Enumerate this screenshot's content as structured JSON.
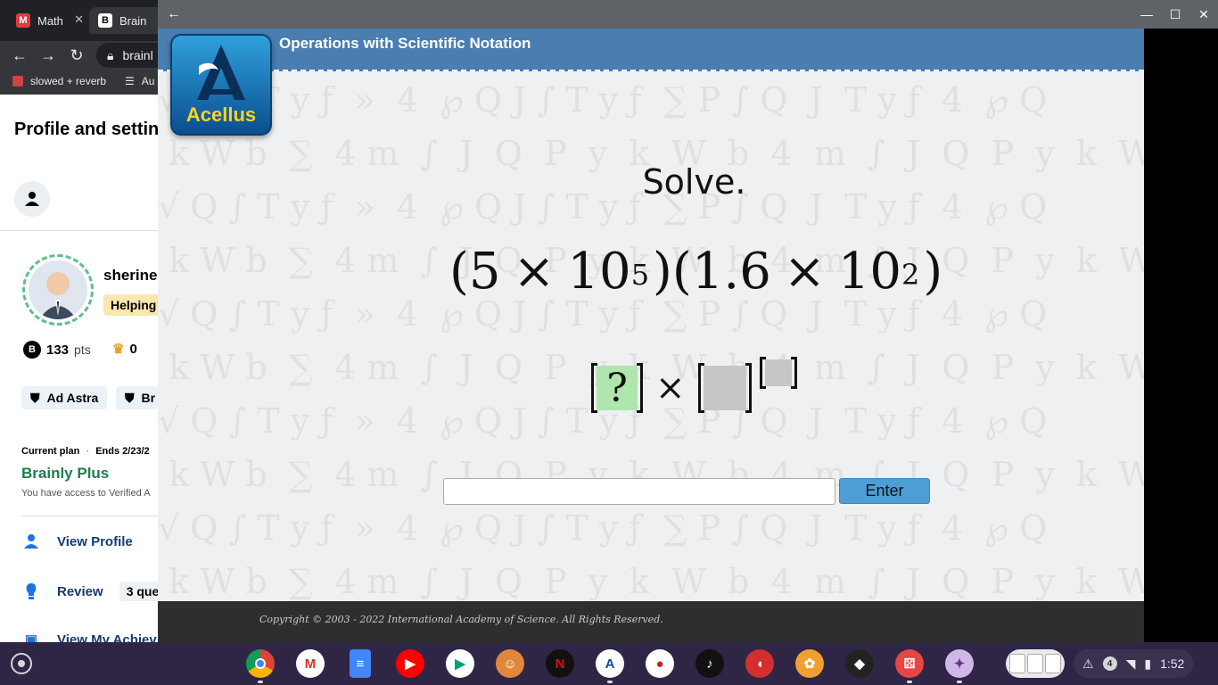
{
  "browser": {
    "tabs": [
      {
        "label": "Math",
        "favicon": "M"
      },
      {
        "label": "Brain",
        "favicon": "B"
      }
    ],
    "url": "brainl",
    "bookmarks": [
      {
        "label": "slowed + reverb"
      },
      {
        "label": "Au"
      }
    ]
  },
  "profile": {
    "title": "Profile and settin",
    "username": "sherine",
    "rank": "Helping",
    "points": "133",
    "points_unit": "pts",
    "crowns": "0",
    "chips": [
      "Ad Astra",
      "Br"
    ],
    "plan": {
      "label": "Current plan",
      "separator": "·",
      "ends": "Ends 2/23/2",
      "name": "Brainly Plus",
      "description": "You have access to Verified A"
    },
    "menu": [
      {
        "label": "View Profile"
      },
      {
        "label": "Review",
        "badge": "3 ques"
      },
      {
        "label": "View My Achiev"
      }
    ]
  },
  "acellus": {
    "lesson_title": "Operations with Scientific Notation",
    "logo_text": "Acellus",
    "prompt": "Solve.",
    "expression": {
      "open1": "(",
      "a": "5",
      "times1": "×",
      "base1": "10",
      "exp1": "5",
      "close1": ")",
      "open2": "(",
      "b": "1.6",
      "times2": "×",
      "base2": "10",
      "exp2": "2",
      "close2": ")"
    },
    "answer_template": {
      "coefficient_placeholder": "?",
      "times": "×"
    },
    "input_value": "",
    "enter_label": "Enter",
    "copyright": "Copyright © 2003 - 2022 International Academy of Science.  All Rights Reserved."
  },
  "shelf": {
    "apps": [
      "chrome",
      "gmail",
      "docs",
      "youtube",
      "play-store",
      "game",
      "netflix",
      "acellus",
      "apple",
      "tiktok",
      "among-us",
      "cookie-game",
      "roblox",
      "dice",
      "anime"
    ],
    "notification_count": "4",
    "time": "1:52"
  },
  "colors": {
    "header_blue": "#4a7db0",
    "enter_blue": "#4e9ed6",
    "answer_green": "#aee6ad",
    "plan_green": "#1e7d4a",
    "shelf": "#2f2645"
  }
}
